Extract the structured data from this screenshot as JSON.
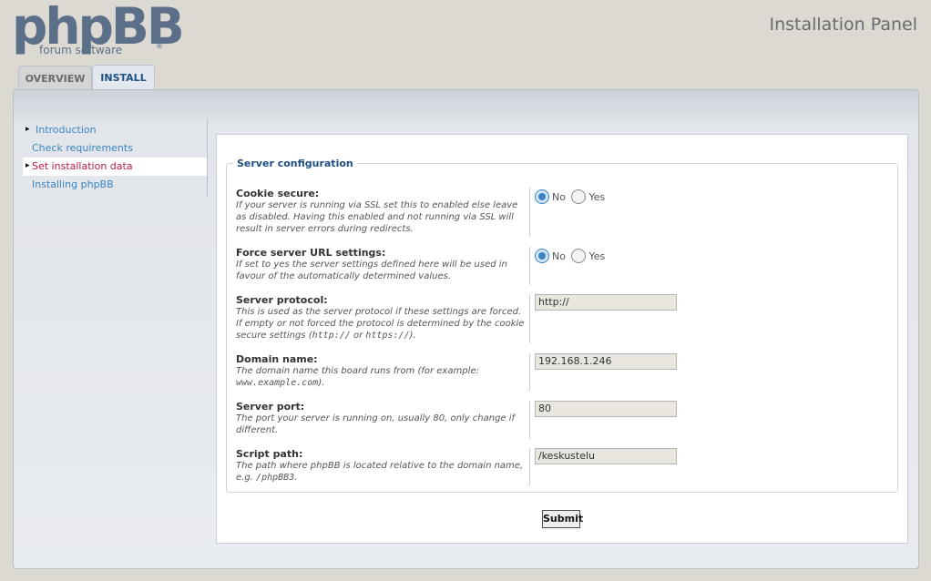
{
  "logo": {
    "text": "phpBB",
    "subtitle": "forum software",
    "reg": "®"
  },
  "header": {
    "panel_title": "Installation Panel"
  },
  "tabs": [
    {
      "label": "OVERVIEW"
    },
    {
      "label": "INSTALL"
    }
  ],
  "menu": [
    {
      "label": "Introduction"
    },
    {
      "label": "Check requirements"
    },
    {
      "label": "Set installation data"
    },
    {
      "label": "Installing phpBB"
    }
  ],
  "form": {
    "legend": "Server configuration",
    "cookie_secure": {
      "label": "Cookie secure:",
      "explain": "If your server is running via SSL set this to enabled else leave as disabled. Having this enabled and not running via SSL will result in server errors during redirects.",
      "no": "No",
      "yes": "Yes",
      "selected": "No"
    },
    "force_server": {
      "label": "Force server URL settings:",
      "explain": "If set to yes the server settings defined here will be used in favour of the automatically determined values.",
      "no": "No",
      "yes": "Yes",
      "selected": "No"
    },
    "protocol": {
      "label": "Server protocol:",
      "explain_a": "This is used as the server protocol if these settings are forced. If empty or not forced the protocol is determined by the cookie secure settings (",
      "code1": "http://",
      "explain_or": " or ",
      "code2": "https://",
      "explain_end": ").",
      "value": "http://"
    },
    "domain": {
      "label": "Domain name:",
      "explain_a": "The domain name this board runs from (for example: ",
      "code": "www.example.com",
      "explain_end": ").",
      "value": "192.168.1.246"
    },
    "port": {
      "label": "Server port:",
      "explain": "The port your server is running on, usually 80, only change if different.",
      "value": "80"
    },
    "script": {
      "label": "Script path:",
      "explain_a": "The path where phpBB is located relative to the domain name, e.g. ",
      "code": "/phpBB3",
      "explain_end": ".",
      "value": "/keskustelu"
    },
    "submit": "Submit"
  }
}
